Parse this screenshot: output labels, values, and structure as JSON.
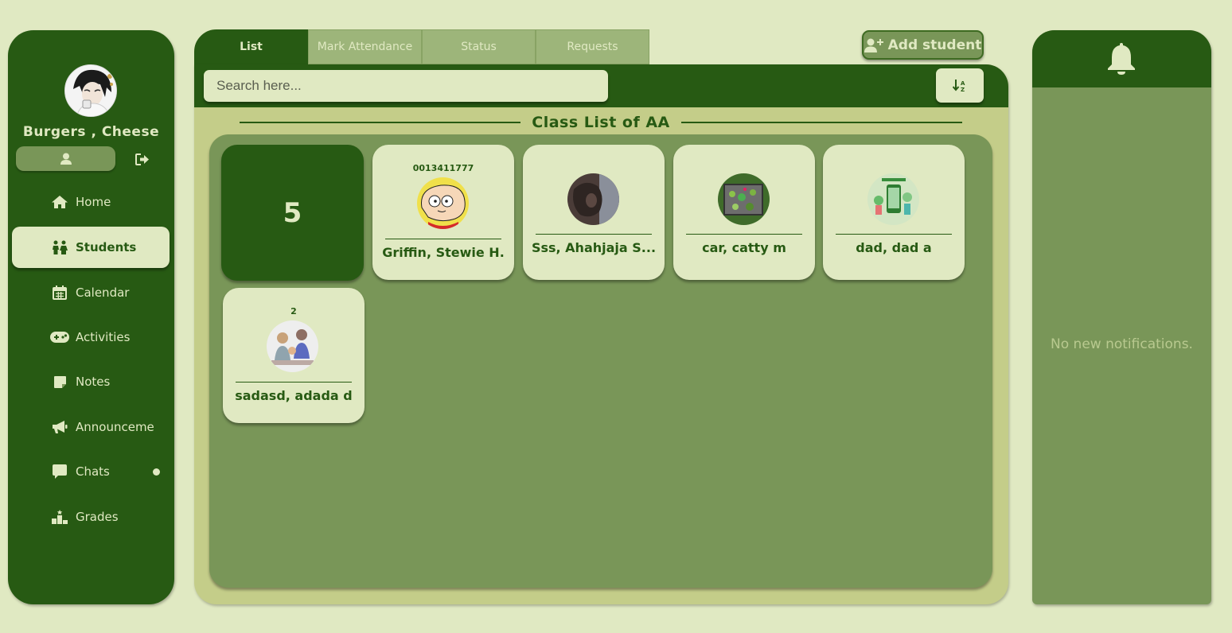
{
  "profile": {
    "name": "Burgers , Cheese"
  },
  "nav": {
    "items": [
      {
        "label": "Home",
        "icon": "home-icon"
      },
      {
        "label": "Students",
        "icon": "students-icon",
        "active": true
      },
      {
        "label": "Calendar",
        "icon": "calendar-icon"
      },
      {
        "label": "Activities",
        "icon": "gamepad-icon"
      },
      {
        "label": "Notes",
        "icon": "note-icon"
      },
      {
        "label": "Announceme",
        "icon": "megaphone-icon"
      },
      {
        "label": "Chats",
        "icon": "chat-icon",
        "unread_dot": true
      },
      {
        "label": "Grades",
        "icon": "podium-icon"
      }
    ]
  },
  "tabs": [
    {
      "label": "List",
      "active": true
    },
    {
      "label": "Mark Attendance"
    },
    {
      "label": "Status"
    },
    {
      "label": "Requests"
    }
  ],
  "toolbar": {
    "add_student_label": "Add student"
  },
  "search": {
    "placeholder": "Search here..."
  },
  "class_list": {
    "title": "Class List of AA",
    "count": "5",
    "students": [
      {
        "id": "0013411777",
        "name": "Griffin, Stewie H.",
        "photo": "cartoon-character"
      },
      {
        "id": "",
        "name": "Sss, Ahahjaja S...",
        "photo": "animal-photo"
      },
      {
        "id": "",
        "name": "car, catty m",
        "photo": "garden-box-photo"
      },
      {
        "id": "",
        "name": "dad, dad a",
        "photo": "app-promo-photo"
      },
      {
        "id": "2",
        "name": "sadasd, adada d",
        "photo": "family-photo"
      }
    ]
  },
  "notifications": {
    "empty_text": "No new notifications."
  },
  "colors": {
    "background": "#e0e9c2",
    "dark_green": "#275a13",
    "mid_green": "#799658",
    "light_green": "#c4cd89"
  }
}
